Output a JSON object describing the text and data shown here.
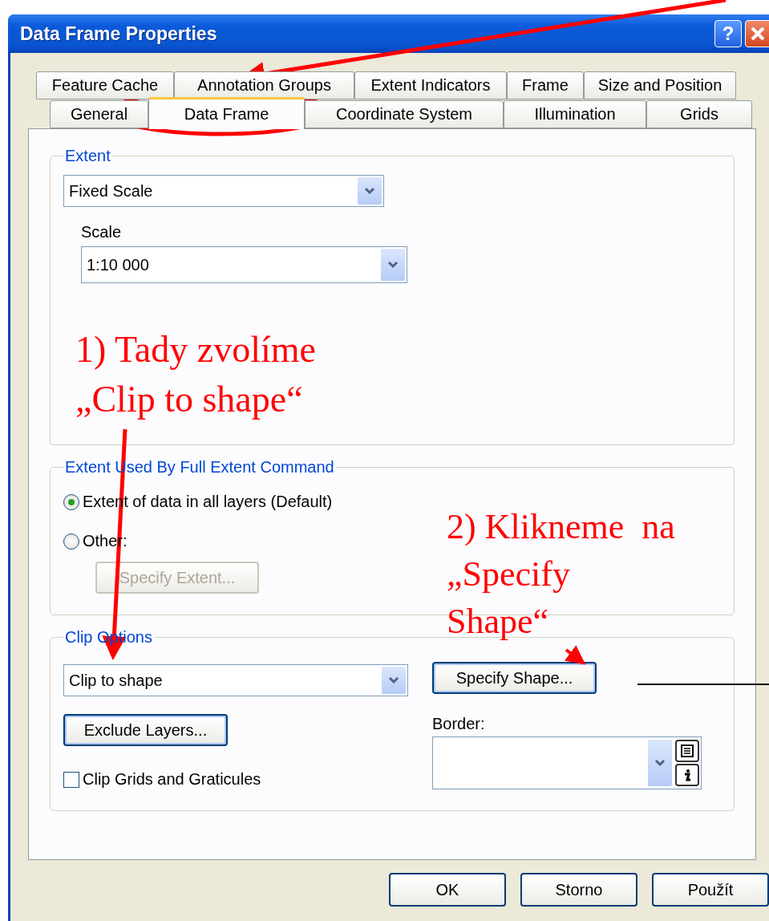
{
  "window": {
    "title": "Data Frame Properties",
    "help_button": "?"
  },
  "tab_rows": [
    {
      "tabs": [
        {
          "label": "Feature Cache",
          "selected": false
        },
        {
          "label": "Annotation Groups",
          "selected": false
        },
        {
          "label": "Extent Indicators",
          "selected": false
        },
        {
          "label": "Frame",
          "selected": false
        },
        {
          "label": "Size and Position",
          "selected": false
        }
      ]
    },
    {
      "tabs": [
        {
          "label": "General",
          "selected": false
        },
        {
          "label": "Data Frame",
          "selected": true
        },
        {
          "label": "Coordinate System",
          "selected": false
        },
        {
          "label": "Illumination",
          "selected": false
        },
        {
          "label": "Grids",
          "selected": false
        }
      ]
    }
  ],
  "extent": {
    "title": "Extent",
    "mode": "Fixed Scale",
    "scale_label": "Scale",
    "scale": "1:10 000"
  },
  "full_extent": {
    "title": "Extent Used By Full Extent Command",
    "options": [
      {
        "label": "Extent of data in all layers (Default)",
        "selected": true
      },
      {
        "label": "Other:",
        "selected": false
      }
    ],
    "button": {
      "label": "Specify Extent...",
      "disabled": true
    }
  },
  "clip_options": {
    "title": "Clip Options",
    "mode": "Clip to shape",
    "specify_button": "Specify Shape...",
    "exclude_button": "Exclude Layers...",
    "border_label": "Border:",
    "clip_grids": {
      "label": "Clip Grids and Graticules",
      "checked": false
    }
  },
  "buttons": [
    "OK",
    "Storno",
    "Použít"
  ],
  "annotations": [
    {
      "text": "1) Tady zvolíme\n„Clip to shape“"
    },
    {
      "text": "2) Klikneme  na\n„Specify\nShape“"
    }
  ]
}
